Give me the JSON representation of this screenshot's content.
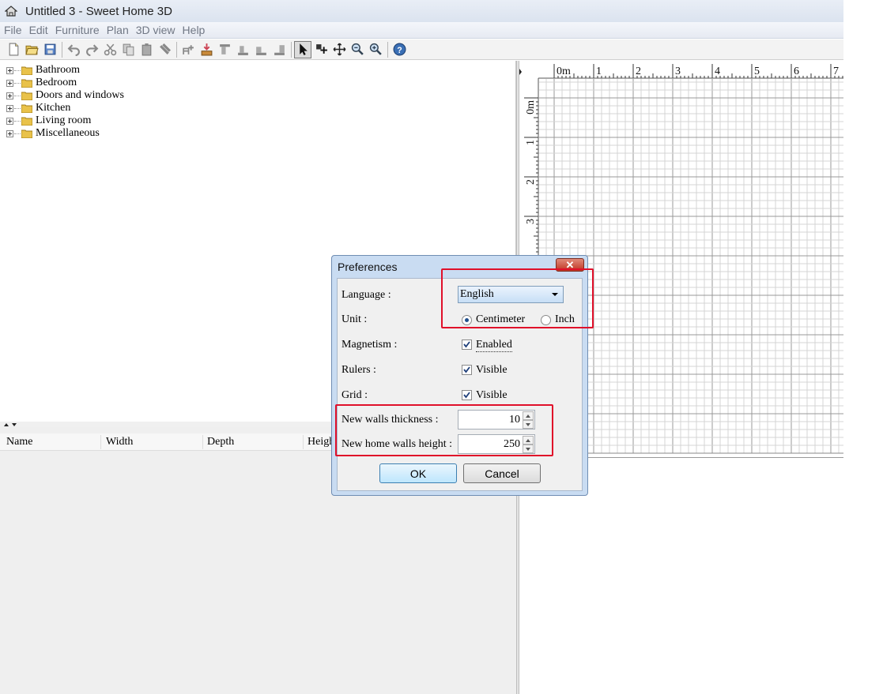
{
  "window": {
    "title": "Untitled 3 - Sweet Home 3D"
  },
  "menu": [
    "File",
    "Edit",
    "Furniture",
    "Plan",
    "3D view",
    "Help"
  ],
  "toolbar_icons": [
    "new-file-icon",
    "open-icon",
    "save-icon",
    "undo-icon",
    "redo-icon",
    "cut-icon",
    "copy-icon",
    "paste-icon",
    "delete-icon",
    "add-furniture-icon",
    "import-furniture-icon",
    "align-top-icon",
    "align-bottom-icon",
    "align-left-icon",
    "align-right-icon",
    "select-mode-icon",
    "create-walls-icon",
    "pan-icon",
    "zoom-out-icon",
    "zoom-in-icon",
    "help-icon"
  ],
  "catalog": {
    "categories": [
      "Bathroom",
      "Bedroom",
      "Doors and windows",
      "Kitchen",
      "Living room",
      "Miscellaneous"
    ]
  },
  "furniture_table": {
    "columns": [
      "Name",
      "Width",
      "Depth",
      "Heigh"
    ]
  },
  "plan": {
    "ruler_x": [
      "0m",
      "1",
      "2",
      "3",
      "4",
      "5",
      "6",
      "7"
    ],
    "ruler_y": [
      "0m",
      "1",
      "2",
      "3"
    ]
  },
  "dialog": {
    "title": "Preferences",
    "close_label": "✕",
    "language_label": "Language :",
    "language_value": "English",
    "unit_label": "Unit :",
    "unit_options": [
      "Centimeter",
      "Inch"
    ],
    "unit_selected": "Centimeter",
    "magnetism_label": "Magnetism :",
    "magnetism_option": "Enabled",
    "rulers_label": "Rulers :",
    "rulers_option": "Visible",
    "grid_label": "Grid :",
    "grid_option": "Visible",
    "walls_thickness_label": "New walls thickness :",
    "walls_thickness_value": "10",
    "walls_height_label": "New home walls height :",
    "walls_height_value": "250",
    "ok_label": "OK",
    "cancel_label": "Cancel"
  },
  "colors": {
    "highlight": "#e0102a",
    "dialog_frame": "#c9dcf2",
    "grid": "#d0d0d0"
  }
}
